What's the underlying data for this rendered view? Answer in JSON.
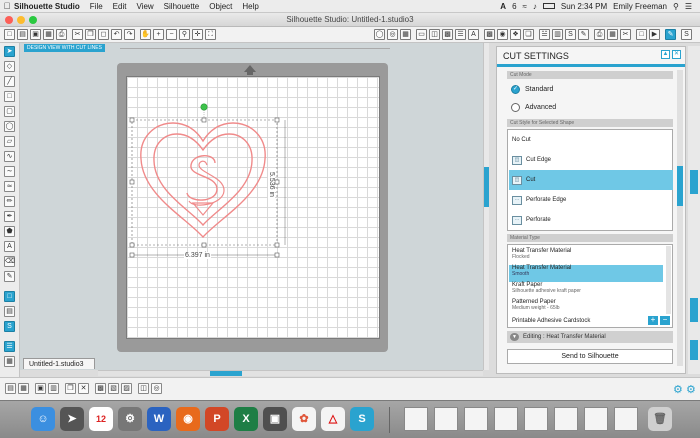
{
  "menubar": {
    "app_name": "Silhouette Studio",
    "menus": [
      "File",
      "Edit",
      "View",
      "Silhouette",
      "Object",
      "Help"
    ],
    "battery_badge": "6",
    "clock": "Sun 2:34 PM",
    "user": "Emily Freeman"
  },
  "window": {
    "title": "Silhouette Studio: Untitled-1.studio3"
  },
  "canvas": {
    "view_tag": "DESIGN VIEW WITH CUT LINES",
    "width_label": "6.397 in",
    "height_label": "5.536 in",
    "doc_tab": "Untitled-1.studio3"
  },
  "panel": {
    "title": "CUT SETTINGS",
    "cut_mode_header": "Cut Mode",
    "modes": [
      {
        "label": "Standard",
        "selected": true
      },
      {
        "label": "Advanced",
        "selected": false
      }
    ],
    "cut_style_header": "Cut Style for Selected Shape",
    "cut_styles": [
      {
        "label": "No Cut",
        "selected": false
      },
      {
        "label": "Cut Edge",
        "selected": false
      },
      {
        "label": "Cut",
        "selected": true
      },
      {
        "label": "Perforate Edge",
        "selected": false
      },
      {
        "label": "Perforate",
        "selected": false
      }
    ],
    "material_header": "Material Type",
    "materials": [
      {
        "name": "Heat Transfer Material",
        "sub": "Flocked",
        "selected": false
      },
      {
        "name": "Heat Transfer Material",
        "sub": "Smooth",
        "selected": true
      },
      {
        "name": "Kraft Paper",
        "sub": "Silhouette adhesive kraft paper",
        "selected": false
      },
      {
        "name": "Patterned Paper",
        "sub": "Medium weight - 65lb",
        "selected": false
      },
      {
        "name": "Printable Adhesive Cardstock",
        "sub": "",
        "selected": false
      }
    ],
    "plus": "+",
    "minus": "−",
    "editing": "Editing : Heat Transfer Material",
    "send_label": "Send to Silhouette"
  },
  "dock": {
    "calendar_day": "12"
  },
  "colors": {
    "accent": "#2aa3cf",
    "selection": "#6fc8e6",
    "cutline": "#f08a8a"
  }
}
